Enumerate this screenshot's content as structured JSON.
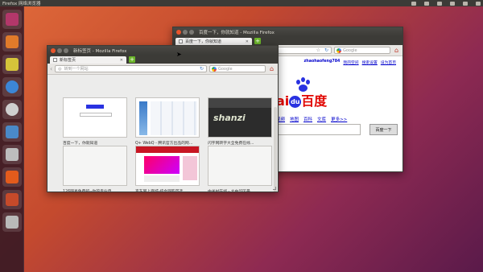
{
  "top_panel": {
    "title": "Firefox 网络浏览器"
  },
  "launcher": {
    "items": [
      {
        "name": "dash-home",
        "color": "#b3376a"
      },
      {
        "name": "files",
        "color": "#e07a2a"
      },
      {
        "name": "archive",
        "color": "#d6c43a"
      },
      {
        "name": "disc",
        "color": "#3c86d6"
      },
      {
        "name": "media",
        "color": "#cfcfcf"
      },
      {
        "name": "system",
        "color": "#4a89c8"
      },
      {
        "name": "trash",
        "color": "#bdbdbd"
      },
      {
        "name": "firefox",
        "color": "#e35b1c"
      },
      {
        "name": "software",
        "color": "#c64a2a"
      },
      {
        "name": "settings",
        "color": "#b9b9b9"
      }
    ]
  },
  "back_window": {
    "title": "百度一下，你就知道 - Mozilla Firefox",
    "tab_label": "百度一下，你就知道",
    "url_text": "",
    "search_engine": "Google",
    "username": "zhaohaofeng784",
    "links": [
      "我的空间",
      "搜索设置",
      "设为首页"
    ],
    "logo_text_left": "ai",
    "logo_du": "du",
    "logo_text_right": "百度",
    "nav_links": [
      "视频",
      "地图",
      "百科",
      "文库",
      "更多>>"
    ],
    "search_button": "百度一下"
  },
  "front_window": {
    "title": "新标签页 - Mozilla Firefox",
    "tab_label": "新标签页",
    "url_placeholder": "转到一个网站",
    "search_engine": "Google",
    "tiles": [
      {
        "label": "百度一下，你就知道",
        "theme": "baidu"
      },
      {
        "label": "Q+ WebQ - 腾讯官方出品的网…",
        "theme": "qq"
      },
      {
        "label": "闪字网转字大全免费在线…",
        "theme": "shanz"
      },
      {
        "label": "126网易免费邮--你的专业电…",
        "theme": "blank"
      },
      {
        "label": "京东网上商城-综合网购首选…",
        "theme": "jd"
      },
      {
        "label": "中关村在线 - 大中华区最…",
        "theme": "blank"
      }
    ],
    "thumb_text_shanz": "shanzi"
  }
}
